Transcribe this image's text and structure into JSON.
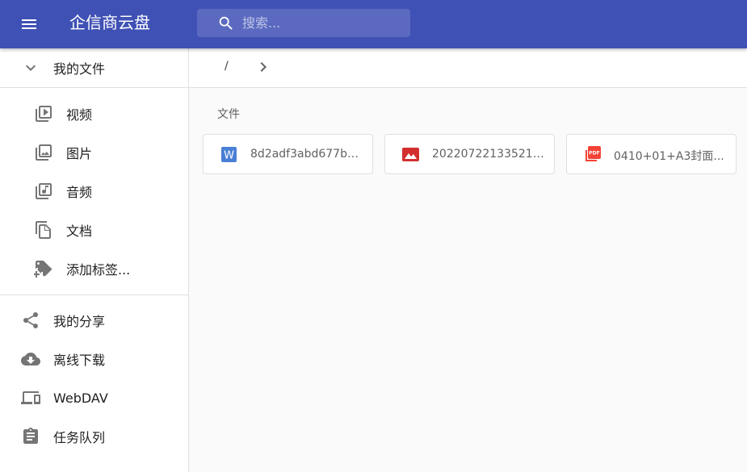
{
  "header": {
    "title": "企信商云盘",
    "search_placeholder": "搜索...",
    "icons": {
      "menu": "menu-icon",
      "search": "search-icon"
    },
    "colors": {
      "appbar": "#3f51b5"
    }
  },
  "sidebar": {
    "my_files": {
      "label": "我的文件",
      "icon": "chevron-down-icon"
    },
    "categories": [
      {
        "label": "视频",
        "icon": "video-library-icon"
      },
      {
        "label": "图片",
        "icon": "photo-library-icon"
      },
      {
        "label": "音频",
        "icon": "library-music-icon"
      },
      {
        "label": "文档",
        "icon": "file-copy-icon"
      },
      {
        "label": "添加标签...",
        "icon": "add-tag-icon"
      }
    ],
    "items": [
      {
        "label": "我的分享",
        "icon": "share-icon"
      },
      {
        "label": "离线下载",
        "icon": "cloud-download-icon"
      },
      {
        "label": "WebDAV",
        "icon": "devices-icon"
      },
      {
        "label": "任务队列",
        "icon": "assignment-icon"
      }
    ]
  },
  "main": {
    "breadcrumb": {
      "root": "/",
      "icon": "chevron-right-icon"
    },
    "section_label": "文件",
    "files": [
      {
        "name": "8d2adf3abd677b6...",
        "type": "word",
        "icon": "word-doc-icon",
        "color": "#4a7fd5"
      },
      {
        "name": "20220722133521.j...",
        "type": "image",
        "icon": "image-file-icon",
        "color": "#d32f2f"
      },
      {
        "name": "0410+01+A3封面...",
        "type": "pdf",
        "icon": "pdf-file-icon",
        "color": "#f44336"
      }
    ]
  }
}
